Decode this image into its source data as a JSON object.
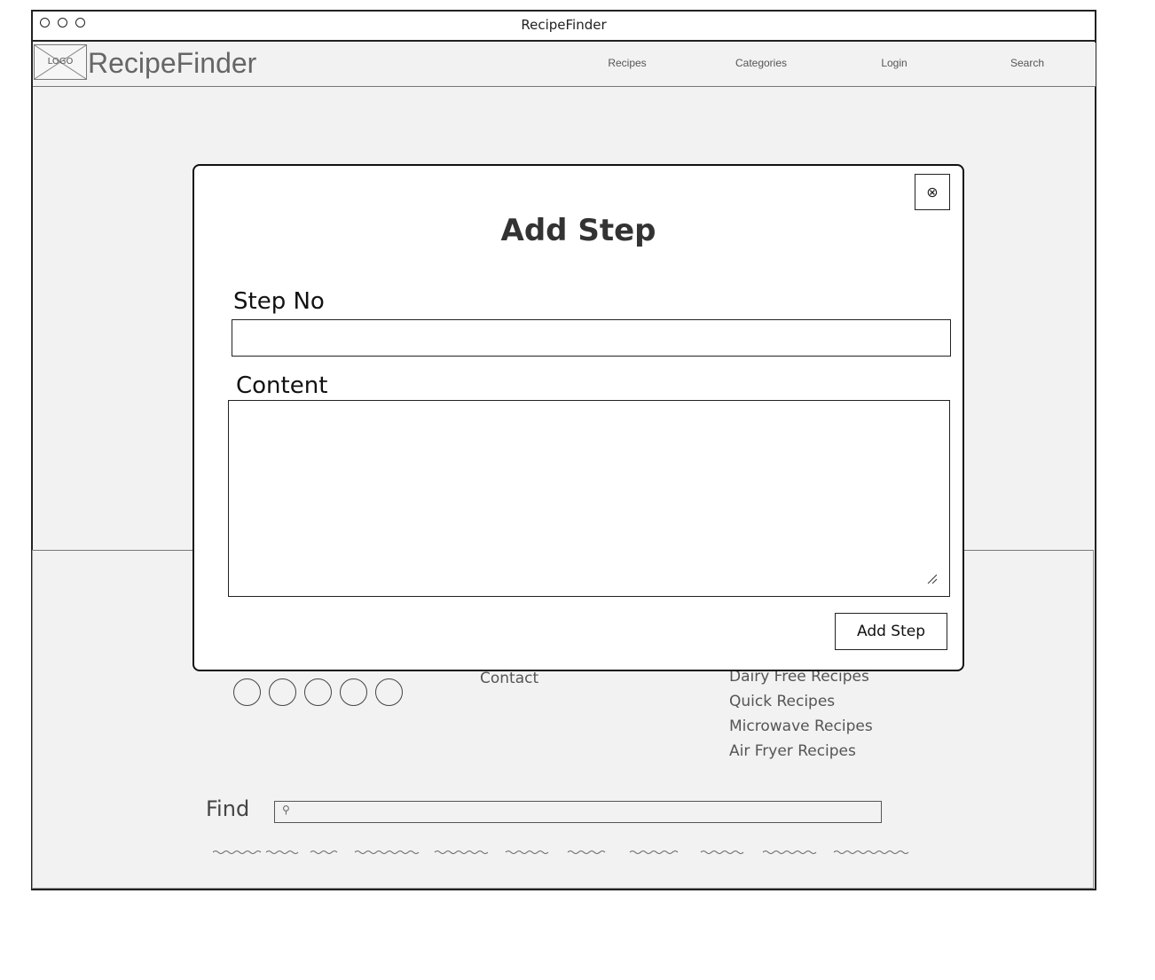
{
  "window": {
    "title": "RecipeFinder"
  },
  "header": {
    "logo_text": "LOGO",
    "brand": "RecipeFinder",
    "nav": [
      "Recipes",
      "Categories",
      "Login",
      "Search"
    ]
  },
  "footer": {
    "contact_label": "Contact",
    "recipe_links": [
      "Dairy Free Recipes",
      "Quick Recipes",
      "Microwave Recipes",
      "Air Fryer Recipes"
    ],
    "find_label": "Find",
    "find_placeholder": "",
    "social_icon_count": 5
  },
  "modal": {
    "title": "Add Step",
    "step_no_label": "Step No",
    "step_no_value": "",
    "content_label": "Content",
    "content_value": "",
    "submit_label": "Add Step",
    "close_icon": "close-circle-icon"
  },
  "colors": {
    "window_bg": "#f2f2f2",
    "modal_bg": "#ffffff",
    "stroke": "#222222"
  }
}
